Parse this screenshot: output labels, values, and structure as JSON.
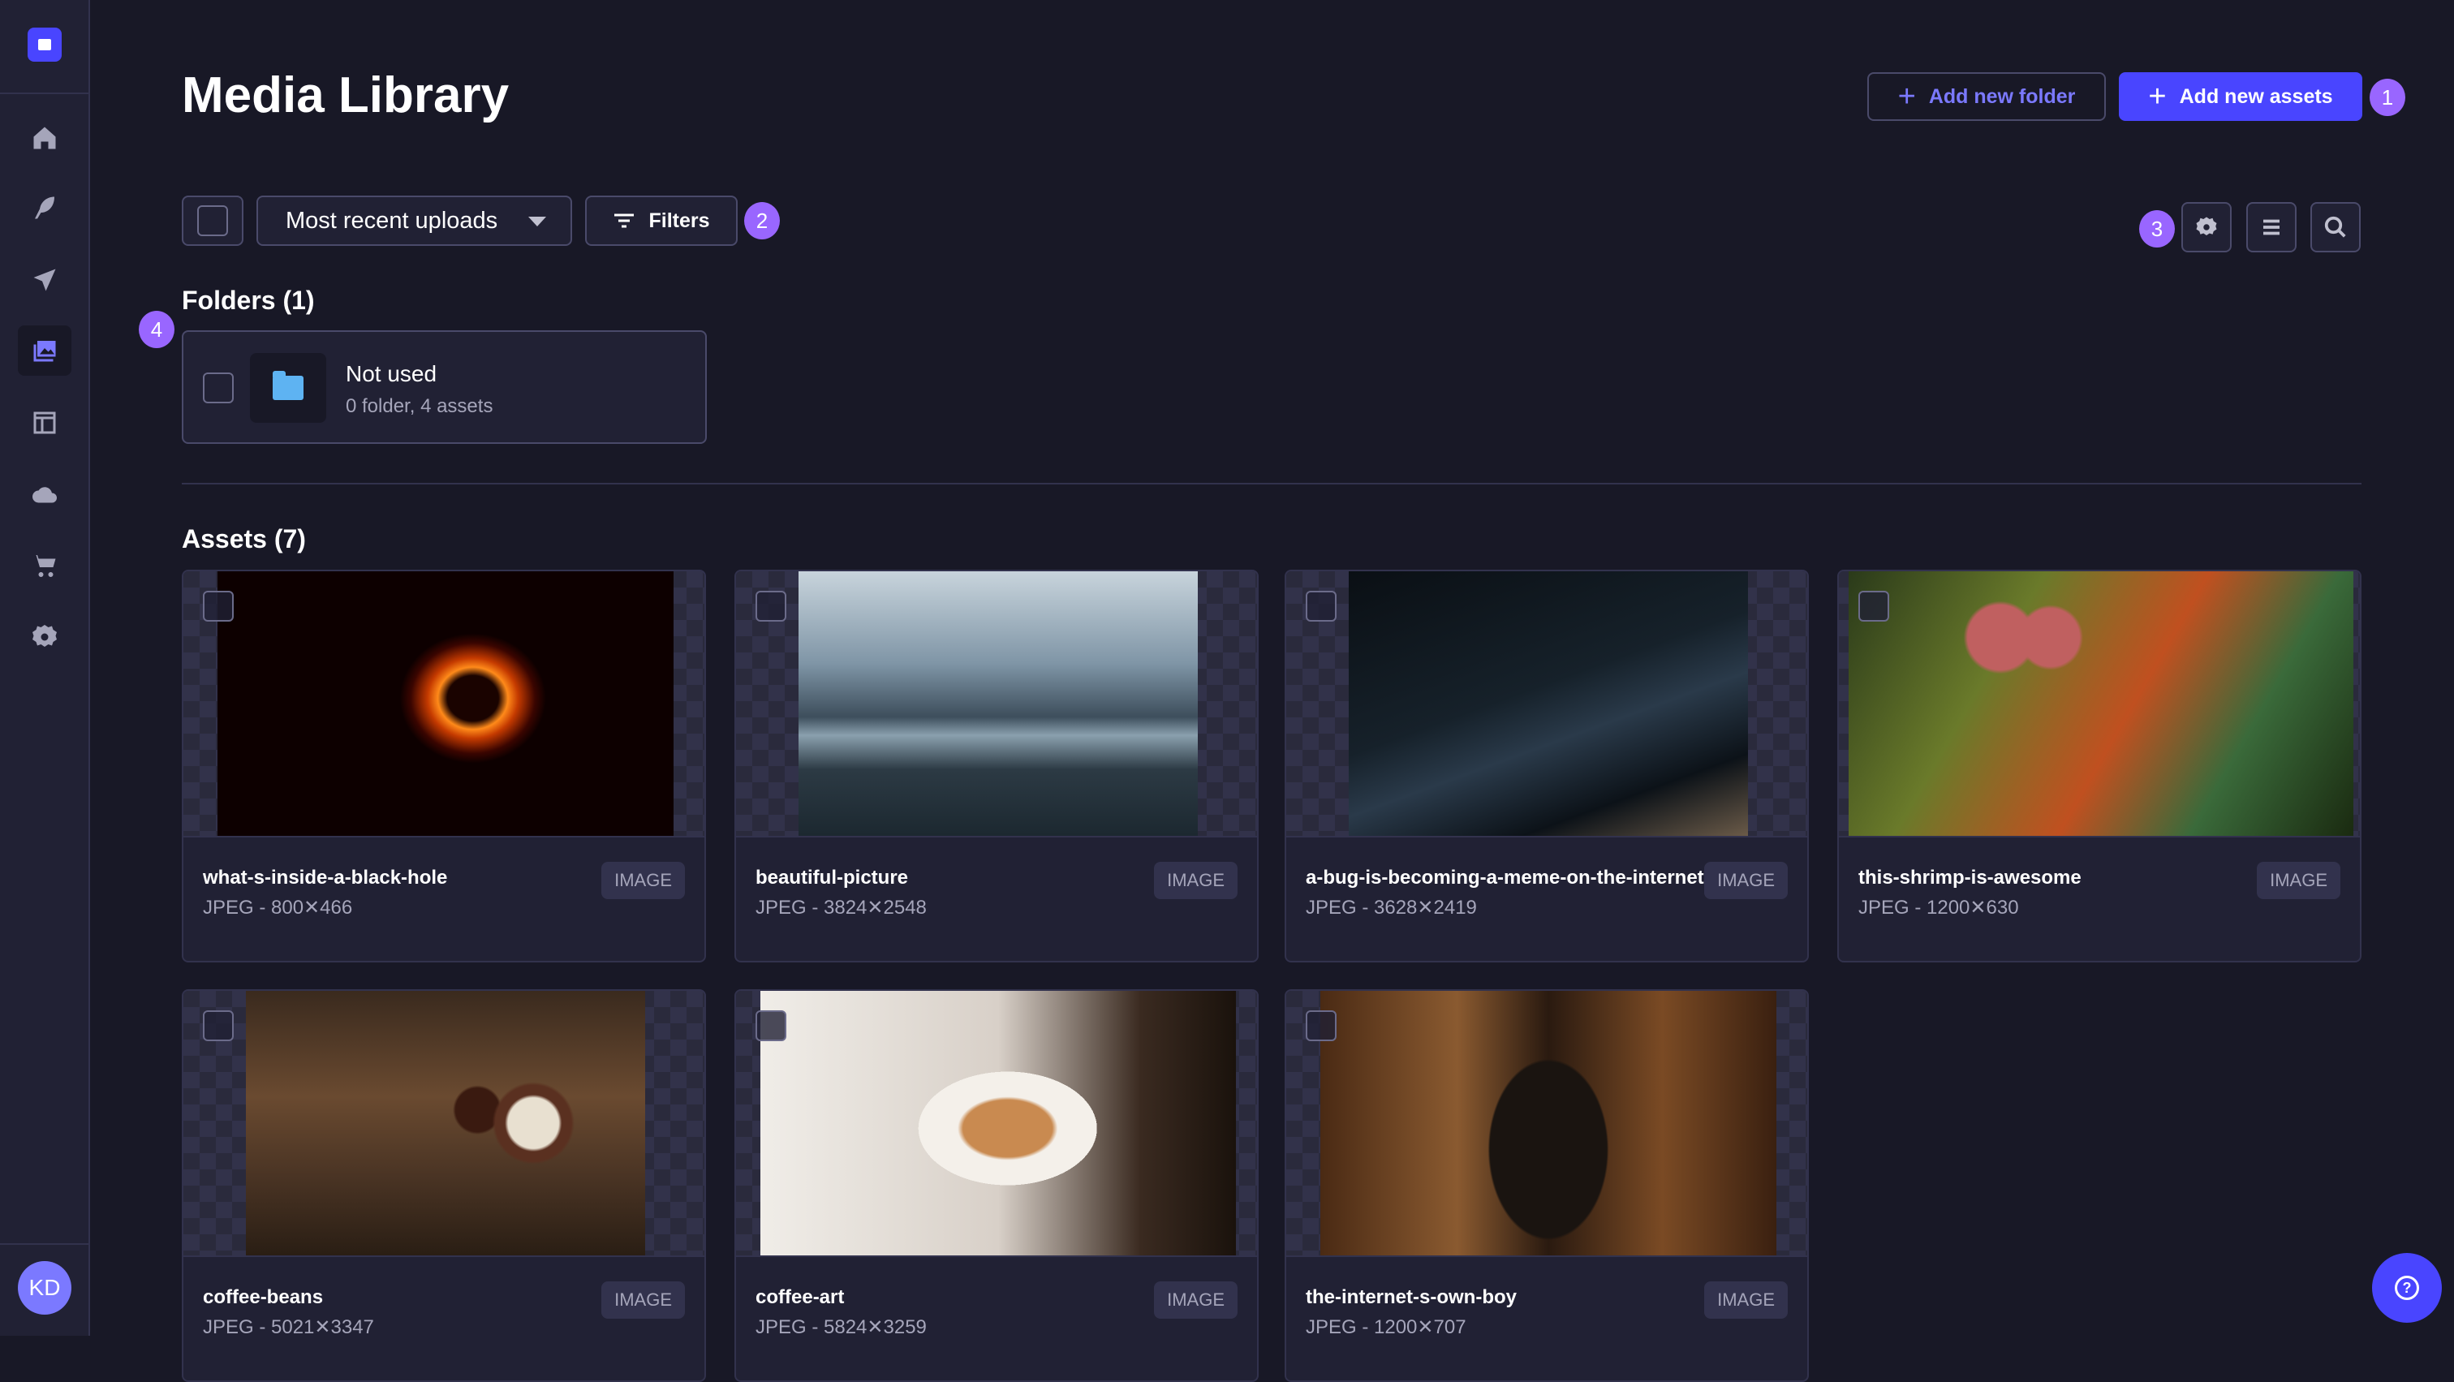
{
  "header": {
    "title": "Media Library",
    "add_folder": "Add new folder",
    "add_assets": "Add new assets"
  },
  "toolbar": {
    "sort_selected": "Most recent uploads",
    "filters": "Filters"
  },
  "badges": [
    "1",
    "2",
    "3",
    "4"
  ],
  "sidebar": {
    "items": [
      "home-icon",
      "content-manager-icon",
      "deploy-icon",
      "media-library-icon",
      "content-type-builder-icon",
      "cloud-icon",
      "marketplace-icon",
      "settings-icon"
    ],
    "active": "media-library-icon",
    "avatar": "KD"
  },
  "folders": {
    "heading": "Folders (1)",
    "items": [
      {
        "name": "Not used",
        "meta": "0 folder, 4 assets"
      }
    ]
  },
  "assets": {
    "heading": "Assets (7)",
    "items": [
      {
        "name": "what-s-inside-a-black-hole",
        "meta": "JPEG - 800✕466",
        "type": "IMAGE"
      },
      {
        "name": "beautiful-picture",
        "meta": "JPEG - 3824✕2548",
        "type": "IMAGE"
      },
      {
        "name": "a-bug-is-becoming-a-meme-on-the-internet",
        "meta": "JPEG - 3628✕2419",
        "type": "IMAGE"
      },
      {
        "name": "this-shrimp-is-awesome",
        "meta": "JPEG - 1200✕630",
        "type": "IMAGE"
      },
      {
        "name": "coffee-beans",
        "meta": "JPEG - 5021✕3347",
        "type": "IMAGE"
      },
      {
        "name": "coffee-art",
        "meta": "JPEG - 5824✕3259",
        "type": "IMAGE"
      },
      {
        "name": "the-internet-s-own-boy",
        "meta": "JPEG - 1200✕707",
        "type": "IMAGE"
      }
    ]
  },
  "colors": {
    "primary": "#4945ff",
    "badge": "#9966ff",
    "background": "#181826",
    "surface": "#212134"
  }
}
